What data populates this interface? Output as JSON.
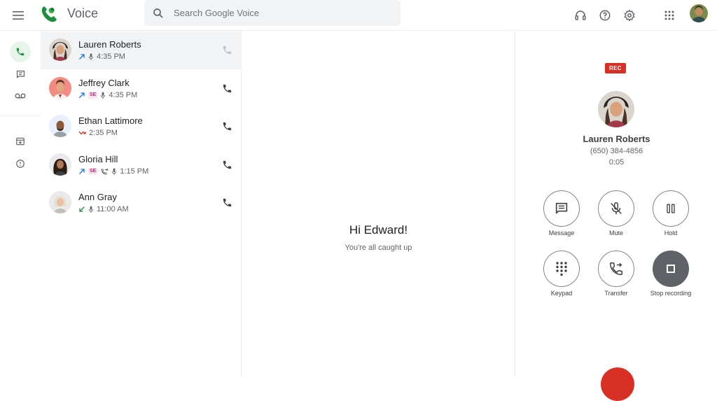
{
  "header": {
    "app_title": "Voice",
    "search_placeholder": "Search Google Voice",
    "icons": [
      "menu-icon",
      "headset-icon",
      "help-icon",
      "settings-icon",
      "apps-grid-icon"
    ]
  },
  "nav": {
    "items": [
      "calls",
      "messages",
      "voicemail",
      "archive",
      "spam"
    ],
    "active": "calls"
  },
  "calls": [
    {
      "name": "Lauren Roberts",
      "direction": "outgoing",
      "badges": [
        "mic"
      ],
      "time": "4:35 PM",
      "selected": true
    },
    {
      "name": "Jeffrey Clark",
      "direction": "outgoing",
      "badges": [
        "SE",
        "mic"
      ],
      "time": "4:35 PM",
      "selected": false
    },
    {
      "name": "Ethan Lattimore",
      "direction": "missed",
      "badges": [],
      "time": "2:35 PM",
      "selected": false
    },
    {
      "name": "Gloria Hill",
      "direction": "outgoing",
      "badges": [
        "SE",
        "transfer",
        "mic"
      ],
      "time": "1:15 PM",
      "selected": false
    },
    {
      "name": "Ann Gray",
      "direction": "incoming",
      "badges": [
        "mic"
      ],
      "time": "11:00 AM",
      "selected": false
    }
  ],
  "center": {
    "greeting": "Hi Edward!",
    "subtitle": "You're all caught up"
  },
  "active_call": {
    "rec_label": "REC",
    "name": "Lauren Roberts",
    "number": "(650) 384-4856",
    "duration": "0:05",
    "controls": [
      {
        "label": "Message"
      },
      {
        "label": "Mute"
      },
      {
        "label": "Hold"
      },
      {
        "label": "Keypad"
      },
      {
        "label": "Transfer"
      },
      {
        "label": "Stop recording"
      }
    ]
  },
  "colors": {
    "brand_green": "#1e8e3e",
    "outgoing_arrow": "#1a73e8",
    "missed_arrow": "#d93025",
    "incoming_arrow": "#1e8e3e",
    "rec_red": "#d93025"
  }
}
